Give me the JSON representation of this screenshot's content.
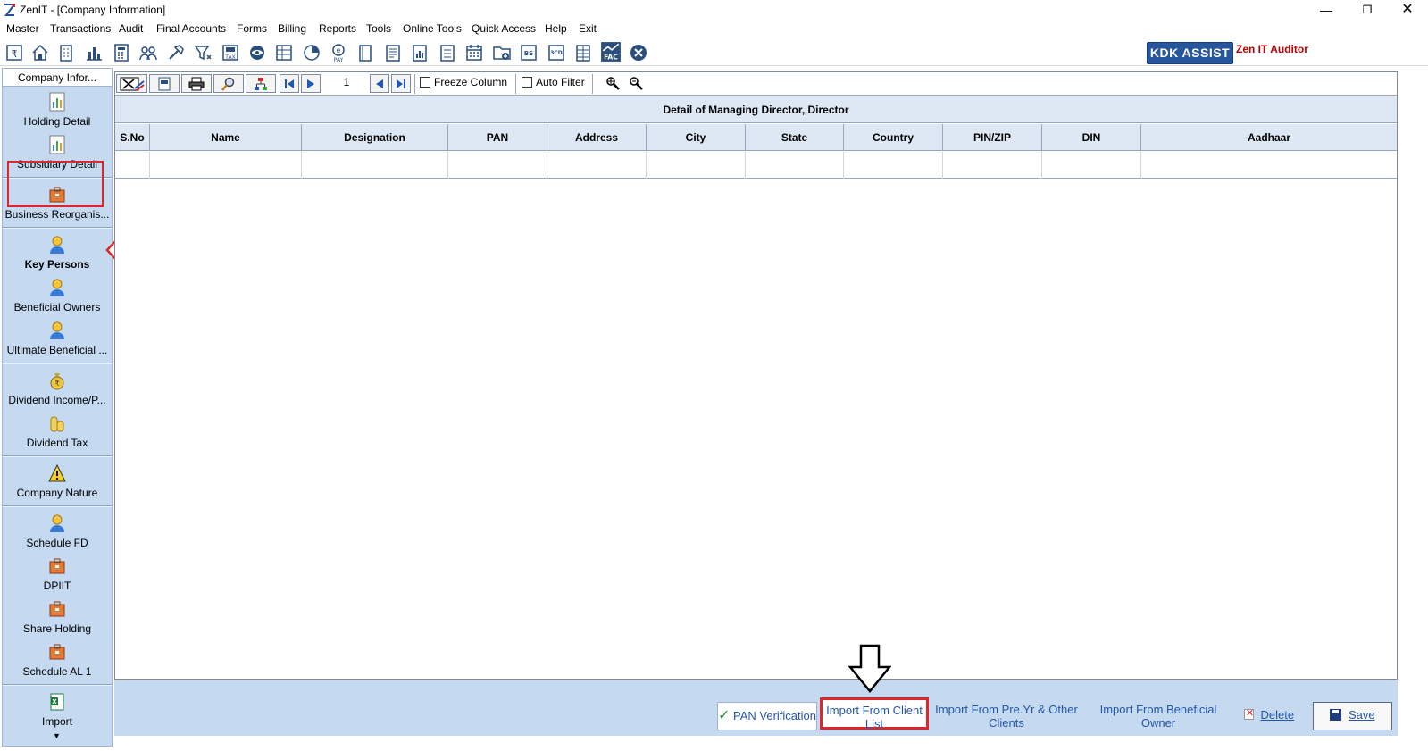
{
  "window": {
    "title": "ZenIT - [Company Information]",
    "minimize_glyph": "—",
    "maximize_glyph": "❐",
    "close_glyph": "✕"
  },
  "menu": [
    "Master",
    "Transactions",
    "Audit",
    "Final Accounts",
    "Forms",
    "Billing",
    "Reports",
    "Tools",
    "Online Tools",
    "Quick Access",
    "Help",
    "Exit"
  ],
  "toolbar": {
    "icons": [
      "rupee-book-icon",
      "home-icon",
      "building-icon",
      "bar-chart-icon",
      "calculator-icon",
      "users-icon",
      "hammer-icon",
      "filter-icon",
      "tax-icon",
      "eye-icon",
      "ledger-icon",
      "pie-chart-icon",
      "pay-icon",
      "book-icon",
      "report-icon",
      "document-chart-icon",
      "calendar-icon",
      "folder-add-icon",
      "bs-icon",
      "3cd-icon",
      "grid-sheet-icon",
      "fac-icon",
      "close-circle-icon"
    ],
    "kdk_assist_label": "KDK ASSIST",
    "zen_auditor_label": "Zen IT Auditor"
  },
  "sidebar": {
    "header": "Company Infor...",
    "items": [
      {
        "label": "Holding Detail",
        "icon": "report-doc-icon"
      },
      {
        "label": "Subsidiary Detail",
        "icon": "report-doc-icon"
      },
      {
        "label": "Business Reorganis...",
        "icon": "briefcase-icon"
      },
      {
        "label": "Key Persons",
        "icon": "person-icon"
      },
      {
        "label": "Beneficial Owners",
        "icon": "person-icon"
      },
      {
        "label": "Ultimate Beneficial ...",
        "icon": "person-icon"
      },
      {
        "label": "Dividend Income/P...",
        "icon": "money-bag-icon"
      },
      {
        "label": "Dividend Tax",
        "icon": "coins-icon"
      },
      {
        "label": "Company Nature",
        "icon": "warning-icon"
      },
      {
        "label": "Schedule FD",
        "icon": "person-icon"
      },
      {
        "label": "DPIIT",
        "icon": "briefcase-icon"
      },
      {
        "label": "Share Holding",
        "icon": "briefcase-icon"
      },
      {
        "label": "Schedule AL 1",
        "icon": "briefcase-icon"
      },
      {
        "label": "Import",
        "icon": "excel-icon"
      }
    ],
    "selected": "Key Persons"
  },
  "grid_toolbar": {
    "page_number": "1",
    "freeze_column_label": "Freeze Column",
    "auto_filter_label": "Auto Filter"
  },
  "grid": {
    "title": "Detail of Managing Director, Director",
    "columns": [
      "S.No",
      "Name",
      "Designation",
      "PAN",
      "Address",
      "City",
      "State",
      "Country",
      "PIN/ZIP",
      "DIN",
      "Aadhaar"
    ],
    "rows": [
      [
        "",
        "",
        "",
        "",
        "",
        "",
        "",
        "",
        "",
        "",
        ""
      ]
    ]
  },
  "actions": {
    "pan_verification": "PAN Verification",
    "import_client_list": "Import From Client List",
    "import_prev_year": "Import From Pre.Yr & Other Clients",
    "import_beneficial": "Import From Beneficial Owner",
    "delete": "Delete",
    "save": "Save"
  }
}
